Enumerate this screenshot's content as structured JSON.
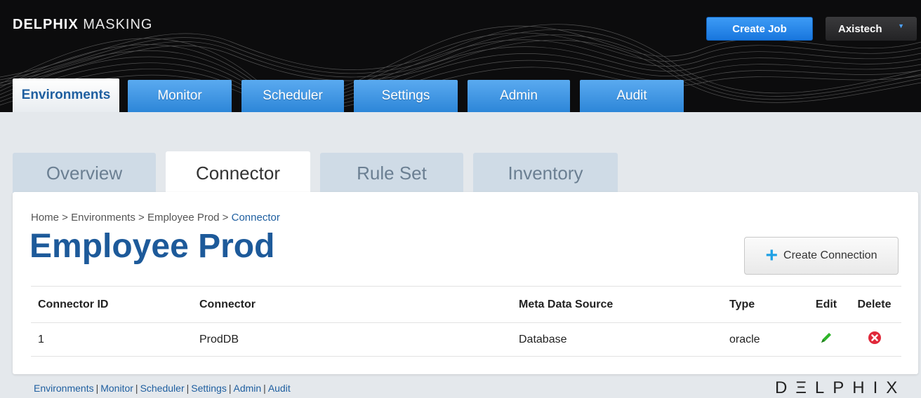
{
  "header": {
    "brand_bold": "DELPHIX",
    "brand_light": "MASKING",
    "create_job_label": "Create Job",
    "user_name": "Axistech",
    "user_caret": "▼"
  },
  "main_tabs": [
    {
      "label": "Environments",
      "active": true
    },
    {
      "label": "Monitor"
    },
    {
      "label": "Scheduler"
    },
    {
      "label": "Settings"
    },
    {
      "label": "Admin"
    },
    {
      "label": "Audit"
    }
  ],
  "sub_tabs": [
    {
      "label": "Overview"
    },
    {
      "label": "Connector",
      "active": true
    },
    {
      "label": "Rule Set"
    },
    {
      "label": "Inventory"
    }
  ],
  "breadcrumb": {
    "home": "Home",
    "environments": "Environments",
    "employee_prod": "Employee Prod",
    "current": "Connector",
    "separator": " > "
  },
  "page_title": "Employee Prod",
  "create_connection_label": "Create Connection",
  "table": {
    "headers": [
      "Connector ID",
      "Connector",
      "Meta Data Source",
      "Type",
      "Edit",
      "Delete"
    ],
    "rows": [
      {
        "id": "1",
        "connector": "ProdDB",
        "meta_source": "Database",
        "type": "oracle"
      }
    ]
  },
  "footer": {
    "links": [
      "Environments",
      "Monitor",
      "Scheduler",
      "Settings",
      "Admin",
      "Audit"
    ],
    "separator": "|",
    "logo": "DΞLPHIX"
  },
  "colors": {
    "accent_blue": "#2d86d8",
    "title_blue": "#1d5a9a",
    "edit_green": "#2fb52a",
    "delete_red": "#e0283a"
  }
}
